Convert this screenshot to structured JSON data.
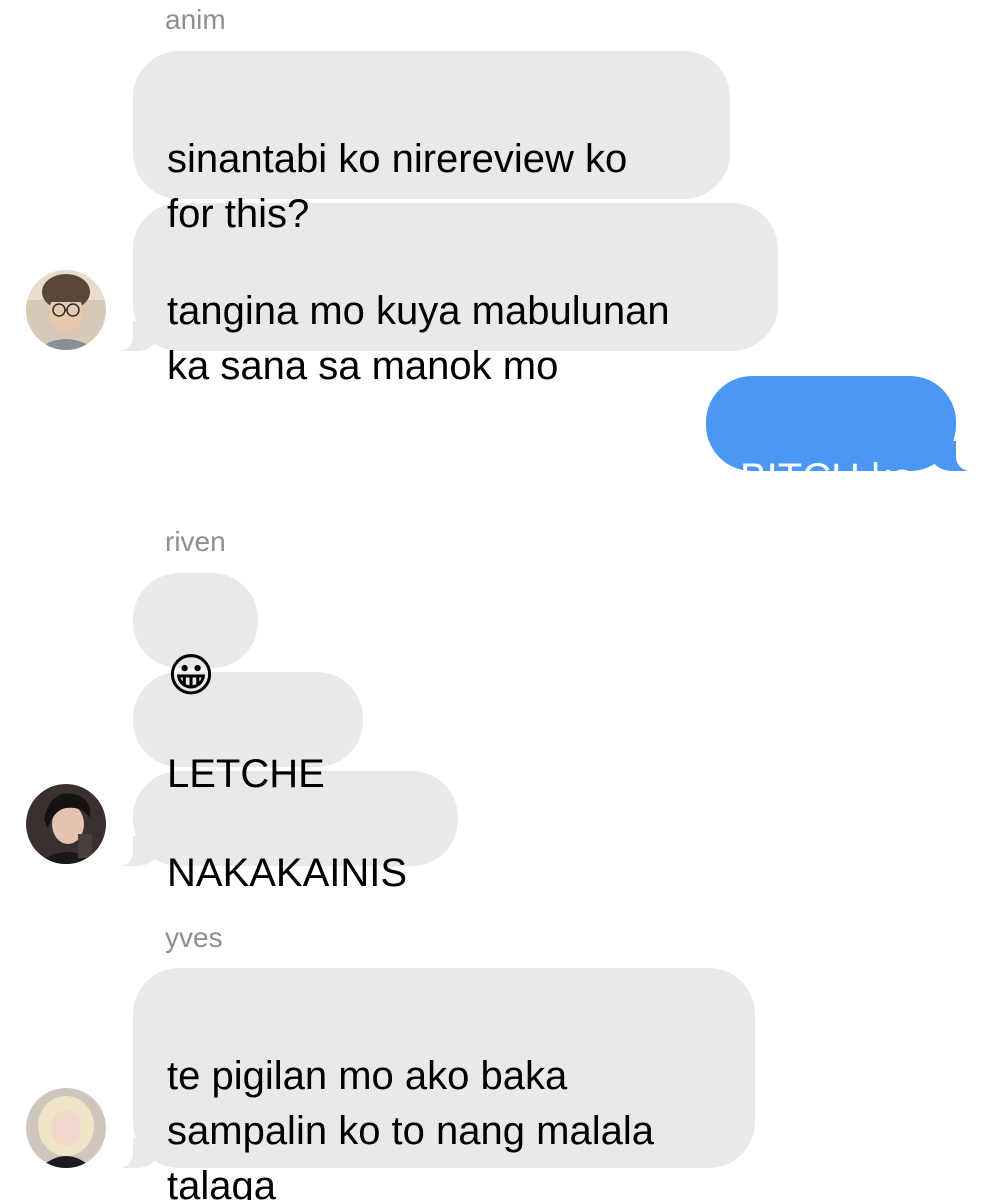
{
  "colors": {
    "incoming_bubble": "#e9e9eb",
    "outgoing_bubble": "#4a98f4",
    "sender_name": "#8e8e93"
  },
  "conversation": {
    "group1": {
      "sender": "anim",
      "messages": [
        "sinantabi ko nirereview ko\nfor this?",
        "tangina mo kuya mabulunan\nka sana sa manok mo"
      ],
      "avatar_icon": "person-with-glasses-avatar"
    },
    "outgoing": {
      "messages": [
        "BITCH ka"
      ]
    },
    "group2": {
      "sender": "riven",
      "messages": [
        "😀",
        "LETCHE",
        "NAKAKAINIS"
      ],
      "avatar_icon": "dark-haired-person-avatar"
    },
    "group3": {
      "sender": "yves",
      "messages": [
        "te pigilan mo ako baka\nsampalin ko to nang malala\ntalaga"
      ],
      "avatar_icon": "blonde-person-avatar"
    }
  }
}
